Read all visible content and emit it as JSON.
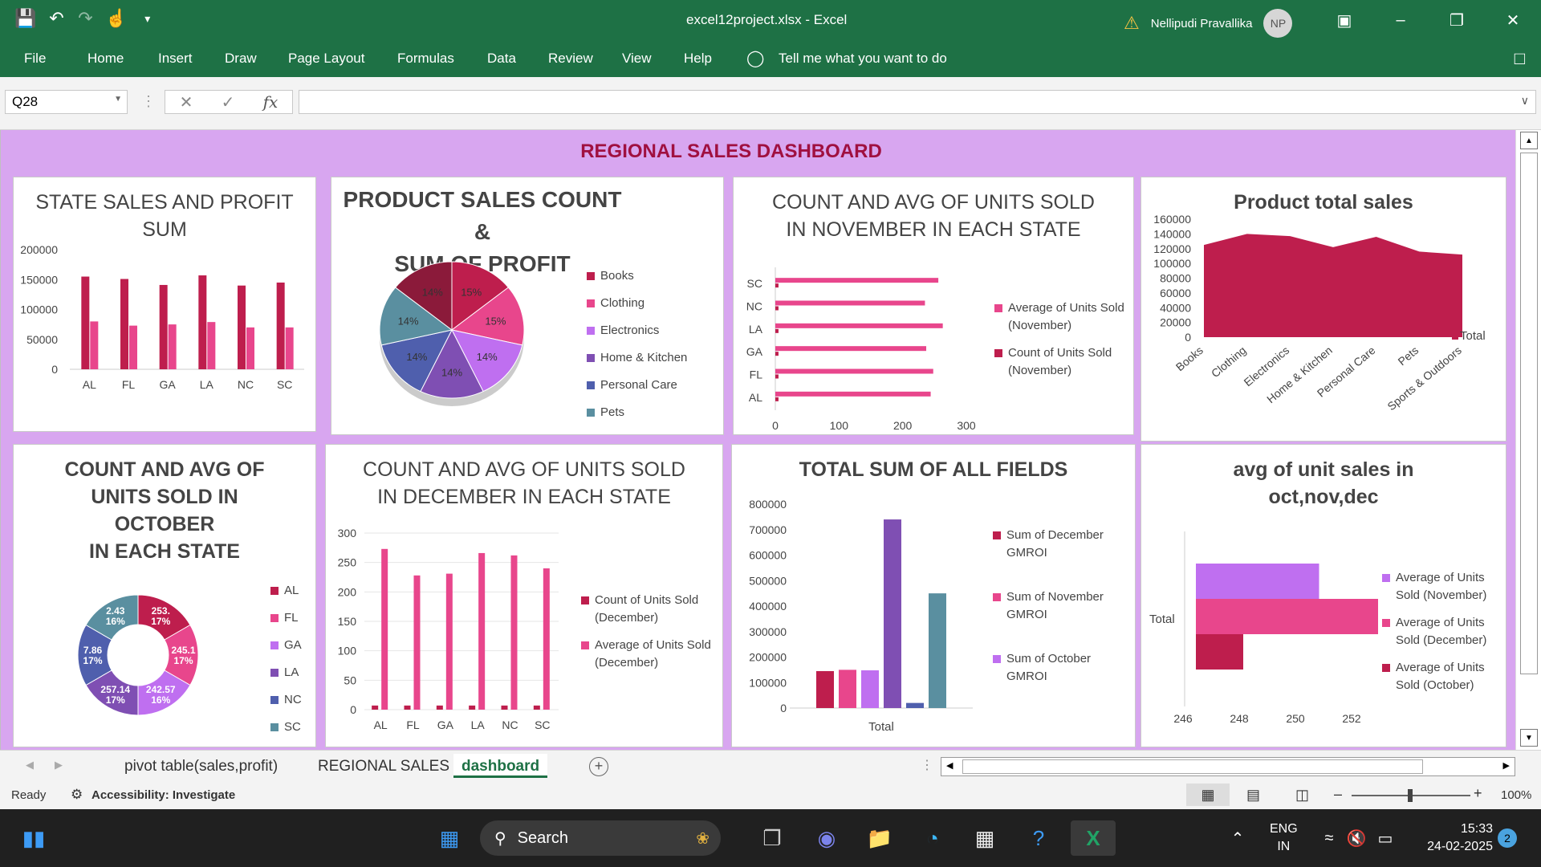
{
  "app": {
    "filename_title": "excel12project.xlsx  -  Excel",
    "user": "Nellipudi Pravallika",
    "initials": "NP"
  },
  "ribbon": {
    "tabs": [
      "File",
      "Home",
      "Insert",
      "Draw",
      "Page Layout",
      "Formulas",
      "Data",
      "Review",
      "View",
      "Help"
    ],
    "tell_me": "Tell me what you want to do"
  },
  "formula_bar": {
    "name_box": "Q28",
    "fx": "fx",
    "value": ""
  },
  "dashboard": {
    "title": "REGIONAL SALES DASHBOARD",
    "p1": {
      "title_l1": "STATE SALES AND PROFIT",
      "title_l2": "SUM",
      "yticks": [
        "200000",
        "150000",
        "100000",
        "50000",
        "0"
      ],
      "cats": [
        "AL",
        "FL",
        "GA",
        "LA",
        "NC",
        "SC"
      ],
      "sales": [
        155000,
        151000,
        141000,
        157000,
        140000,
        145000
      ],
      "profit": [
        80000,
        73000,
        75000,
        79000,
        70000,
        70000
      ],
      "colors": [
        "#be1e4d",
        "#e8468c"
      ]
    },
    "p2": {
      "title_l1": "PRODUCT SALES COUNT &",
      "title_l2": "SUM OF PROFIT",
      "legend": [
        "Books",
        "Clothing",
        "Electronics",
        "Home & Kitchen",
        "Personal Care",
        "Pets"
      ],
      "labels": [
        "15%",
        "15%",
        "14%",
        "14%",
        "14%",
        "14%",
        "14%"
      ],
      "colors": [
        "#be1e4d",
        "#e8468c",
        "#bf6ff0",
        "#7f4fb3",
        "#4f5fad",
        "#5a8fa0",
        "#8b1a3a"
      ]
    },
    "p3": {
      "title_l1": "COUNT AND AVG OF UNITS SOLD",
      "title_l2": "IN NOVEMBER IN EACH STATE",
      "cats": [
        "SC",
        "NC",
        "LA",
        "GA",
        "FL",
        "AL"
      ],
      "avg": [
        256,
        235,
        263,
        237,
        248,
        244
      ],
      "count": [
        5,
        5,
        5,
        5,
        5,
        5
      ],
      "xticks": [
        "0",
        "100",
        "200",
        "300"
      ],
      "legend": [
        "Average of Units Sold (November)",
        "Count of Units Sold (November)"
      ],
      "colors": [
        "#e8468c",
        "#be1e4d"
      ]
    },
    "p4": {
      "title": "Product total sales",
      "yticks": [
        "160000",
        "140000",
        "120000",
        "100000",
        "80000",
        "60000",
        "40000",
        "20000",
        "0"
      ],
      "cats": [
        "Books",
        "Clothing",
        "Electronics",
        "Home & Kitchen",
        "Personal Care",
        "Pets",
        "Sports & Outdoors"
      ],
      "values": [
        125000,
        140000,
        137000,
        122000,
        136000,
        116000,
        112000
      ],
      "legend": "Total",
      "color": "#be1e4d"
    },
    "p5": {
      "title_l1": "COUNT AND AVG OF",
      "title_l2": "UNITS SOLD IN",
      "title_l3": "OCTOBER",
      "title_l4": "IN EACH STATE",
      "legend": [
        "AL",
        "FL",
        "GA",
        "LA",
        "NC",
        "SC"
      ],
      "colors": [
        "#be1e4d",
        "#e8468c",
        "#bf6ff0",
        "#7f4fb3",
        "#4f5fad",
        "#5a8fa0"
      ],
      "labels": [
        "253.",
        "17%",
        "245.1",
        "17%",
        "242.57",
        "16%",
        "257.14",
        "17%",
        "7.86",
        "17%",
        "2.43",
        "16%"
      ]
    },
    "p6": {
      "title_l1": "COUNT AND AVG OF UNITS SOLD",
      "title_l2": "IN DECEMBER IN EACH STATE",
      "yticks": [
        "300",
        "250",
        "200",
        "150",
        "100",
        "50",
        "0"
      ],
      "cats": [
        "AL",
        "FL",
        "GA",
        "LA",
        "NC",
        "SC"
      ],
      "count": [
        7,
        7,
        7,
        7,
        7,
        7
      ],
      "avg": [
        273,
        228,
        231,
        266,
        262,
        240
      ],
      "legend": [
        "Count of Units Sold (December)",
        "Average of Units Sold (December)"
      ],
      "colors": [
        "#be1e4d",
        "#e8468c"
      ]
    },
    "p7": {
      "title": "TOTAL SUM OF ALL FIELDS",
      "yticks": [
        "800000",
        "700000",
        "600000",
        "500000",
        "400000",
        "300000",
        "200000",
        "100000",
        "0"
      ],
      "xlabel": "Total",
      "values": [
        145000,
        150000,
        148000,
        740000,
        20000,
        450000
      ],
      "colors": [
        "#be1e4d",
        "#e8468c",
        "#bf6ff0",
        "#7f4fb3",
        "#4f5fad",
        "#5a8fa0"
      ],
      "legend": [
        "Sum of December GMROI",
        "Sum of November GMROI",
        "Sum of October GMROI"
      ]
    },
    "p8": {
      "title_l1": "avg of unit sales in",
      "title_l2": "oct,nov,dec",
      "category": "Total",
      "xticks": [
        "246",
        "248",
        "250",
        "252"
      ],
      "values": [
        250.5,
        252.6,
        247.8
      ],
      "legend": [
        "Average of Units Sold (November)",
        "Average of Units Sold (December)",
        "Average of Units Sold (October)"
      ],
      "colors": [
        "#bf6ff0",
        "#e8468c",
        "#be1e4d"
      ]
    }
  },
  "sheet_tabs": [
    "pivot table(sales,profit)",
    "REGIONAL SALES",
    "dashboard"
  ],
  "status": {
    "ready": "Ready",
    "accessibility": "Accessibility: Investigate",
    "zoom": "100%"
  },
  "taskbar": {
    "search": "Search",
    "lang1": "ENG",
    "lang2": "IN",
    "time": "15:33",
    "date": "24-02-2025",
    "notif": "2"
  }
}
